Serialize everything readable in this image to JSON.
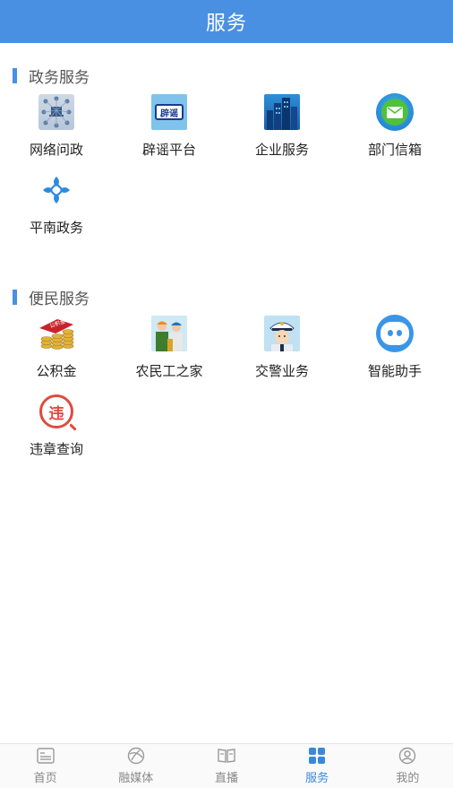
{
  "header": {
    "title": "服务"
  },
  "sections": [
    {
      "title": "政务服务",
      "items": [
        {
          "label": "网络问政",
          "icon": "network-icon"
        },
        {
          "label": "辟谣平台",
          "icon": "rumor-sign-icon",
          "icon_text": "辟谣"
        },
        {
          "label": "企业服务",
          "icon": "city-buildings-icon"
        },
        {
          "label": "部门信箱",
          "icon": "mail-icon"
        },
        {
          "label": "平南政务",
          "icon": "knot-icon"
        }
      ]
    },
    {
      "title": "便民服务",
      "items": [
        {
          "label": "公积金",
          "icon": "fund-coins-icon",
          "icon_text": "公积金"
        },
        {
          "label": "农民工之家",
          "icon": "workers-icon"
        },
        {
          "label": "交警业务",
          "icon": "police-icon"
        },
        {
          "label": "智能助手",
          "icon": "robot-icon"
        },
        {
          "label": "违章查询",
          "icon": "violation-search-icon",
          "icon_text": "违"
        }
      ]
    }
  ],
  "tabbar": {
    "tabs": [
      {
        "label": "首页",
        "icon": "home-icon",
        "active": false
      },
      {
        "label": "融媒体",
        "icon": "media-globe-icon",
        "active": false
      },
      {
        "label": "直播",
        "icon": "live-book-icon",
        "active": false
      },
      {
        "label": "服务",
        "icon": "services-grid-icon",
        "active": true
      },
      {
        "label": "我的",
        "icon": "profile-icon",
        "active": false
      }
    ]
  },
  "colors": {
    "brand": "#4a90e2",
    "tab_active": "#3a88d8",
    "tab_inactive": "#888888",
    "violation_red": "#e04a3e"
  }
}
